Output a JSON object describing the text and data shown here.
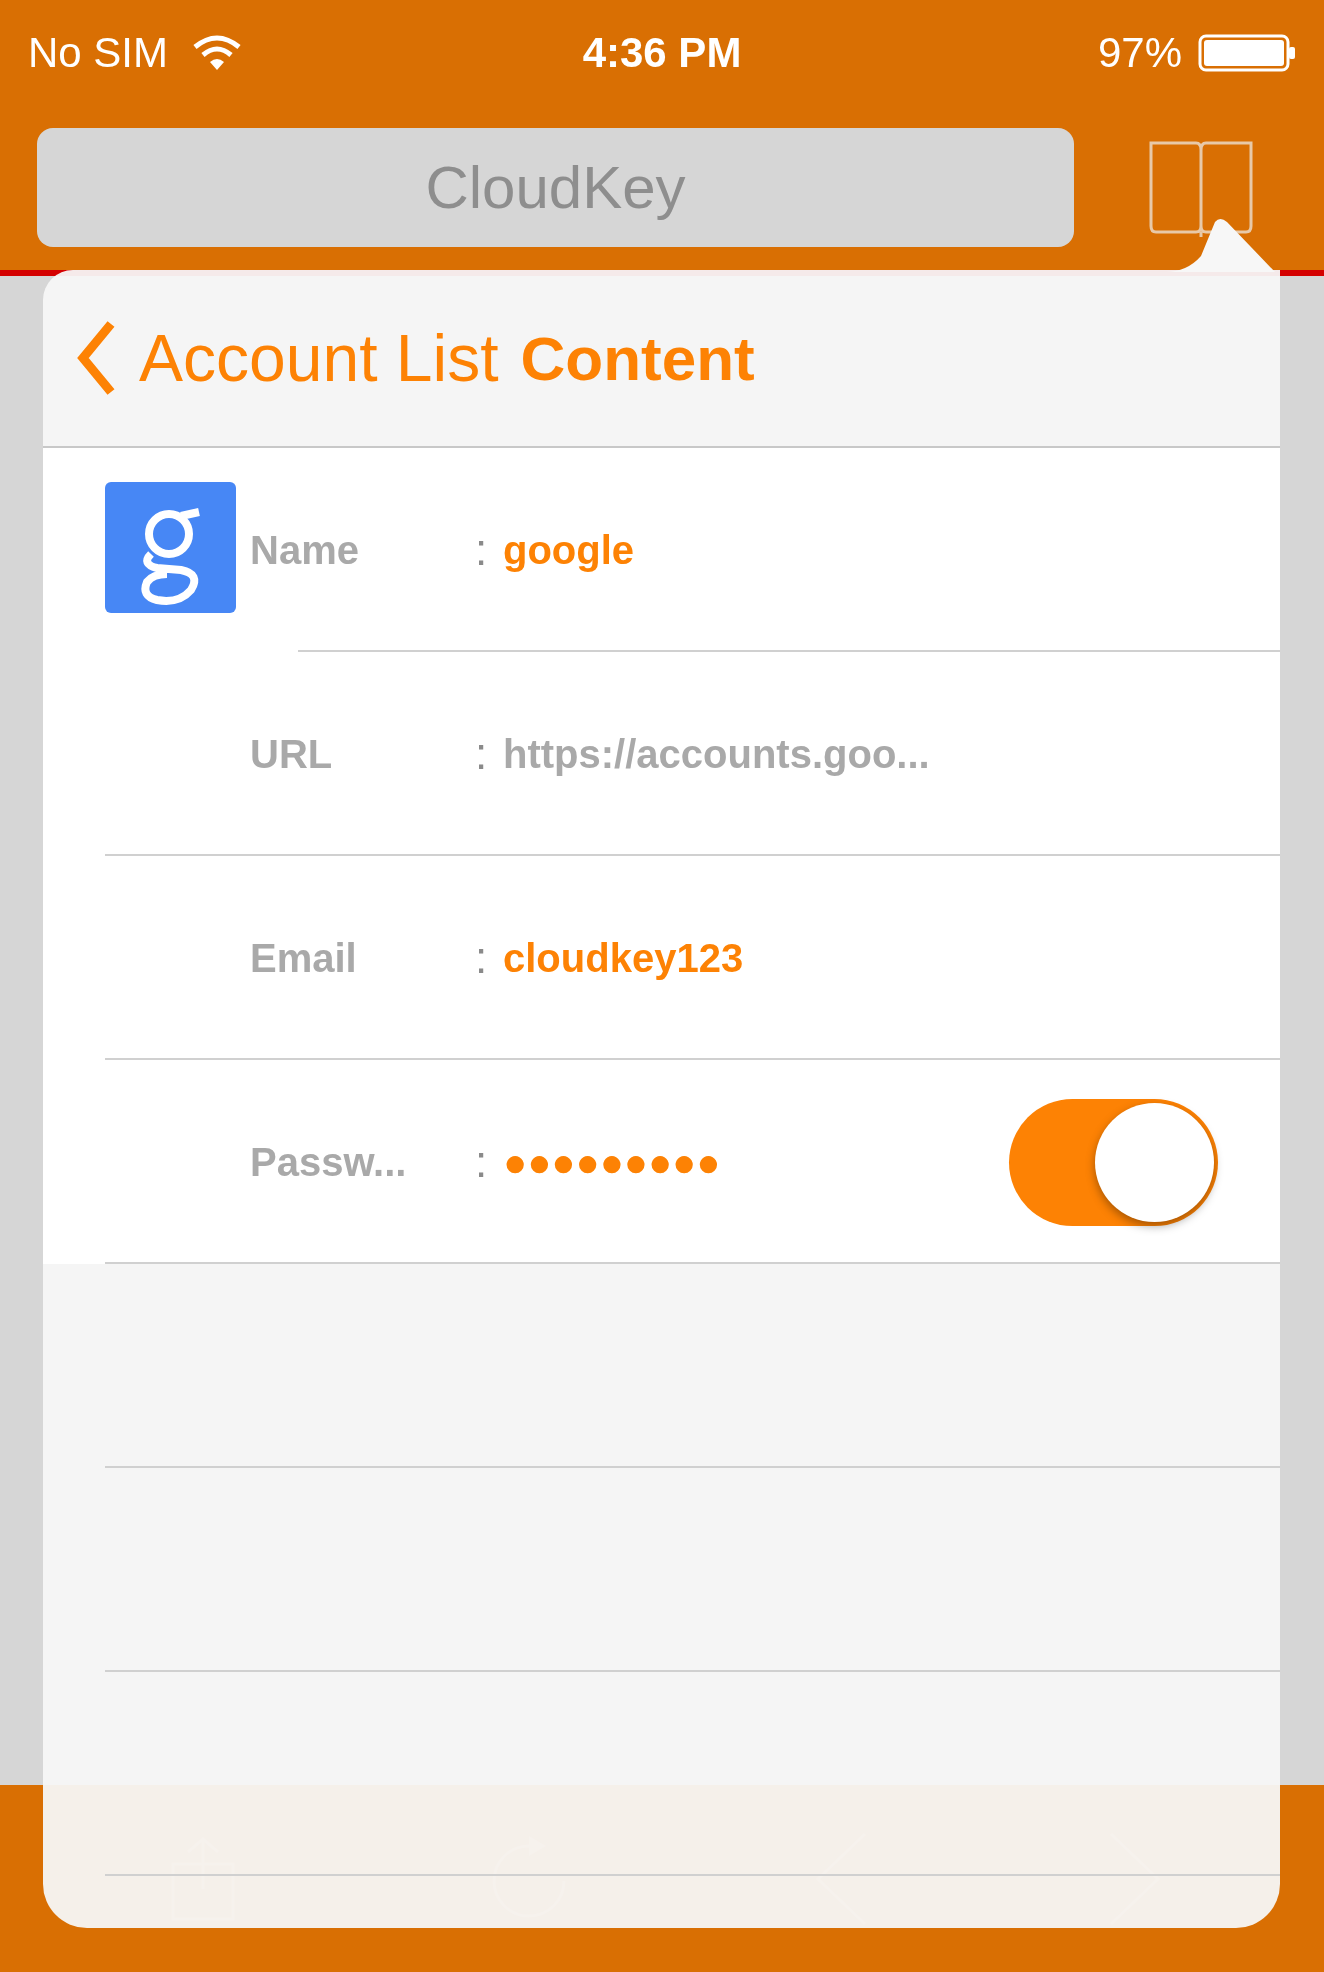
{
  "status_bar": {
    "carrier": "No SIM",
    "time": "4:36 PM",
    "battery": "97%"
  },
  "nav_bar": {
    "search_text": "CloudKey"
  },
  "popover": {
    "back_label": "Account List",
    "title": "Content",
    "fields": [
      {
        "label": "Name",
        "separator": ":",
        "value": "google",
        "kind": "accent",
        "logo": true
      },
      {
        "label": "URL",
        "separator": ":",
        "value": "https://accounts.goo...",
        "kind": "muted"
      },
      {
        "label": "Email",
        "separator": ":",
        "value": "cloudkey123",
        "kind": "accent"
      },
      {
        "label": "Passw...",
        "separator": ":",
        "value": "●●●●●●●●●",
        "kind": "accent",
        "toggle": {
          "on": true
        }
      }
    ]
  }
}
